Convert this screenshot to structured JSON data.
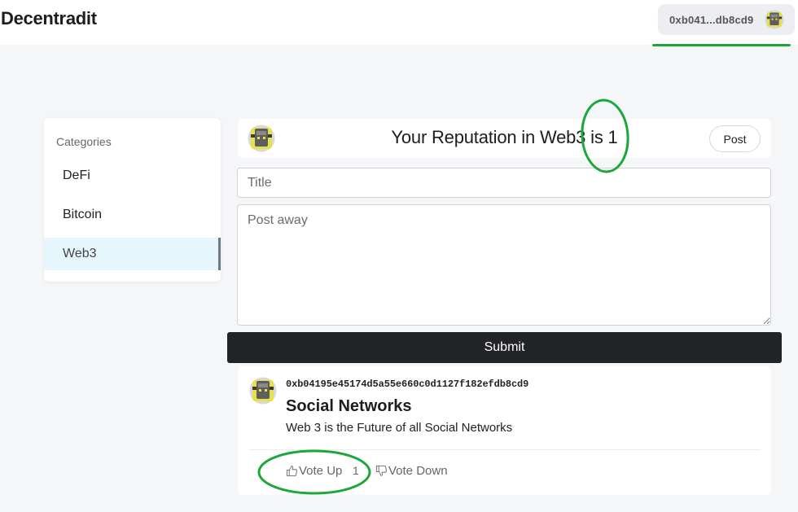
{
  "app": {
    "brand": "Decentradit",
    "account_label": "0xb041...db8cd9"
  },
  "sidebar": {
    "heading": "Categories",
    "items": [
      {
        "label": "DeFi",
        "active": false
      },
      {
        "label": "Bitcoin",
        "active": false
      },
      {
        "label": "Web3",
        "active": true
      }
    ]
  },
  "reputation": {
    "title": "Your Reputation in Web3 is 1",
    "post_button": "Post"
  },
  "composer": {
    "title_placeholder": "Title",
    "body_placeholder": "Post away",
    "submit_label": "Submit"
  },
  "post": {
    "author": "0xb04195e45174d5a55e660c0d1127f182efdb8cd9",
    "title": "Social Networks",
    "body": "Web 3 is the Future of all Social Networks",
    "vote_up_label": "Vote Up",
    "vote_count": "1",
    "vote_down_label": "Vote Down"
  },
  "colors": {
    "annotation": "#1aa83a",
    "submit_bg": "#222427",
    "active_category_bg": "#e6f6fd"
  },
  "icons": {
    "avatar": "robot-avatar-icon",
    "vote_up": "thumbs-up-icon",
    "vote_down": "thumbs-down-icon"
  }
}
